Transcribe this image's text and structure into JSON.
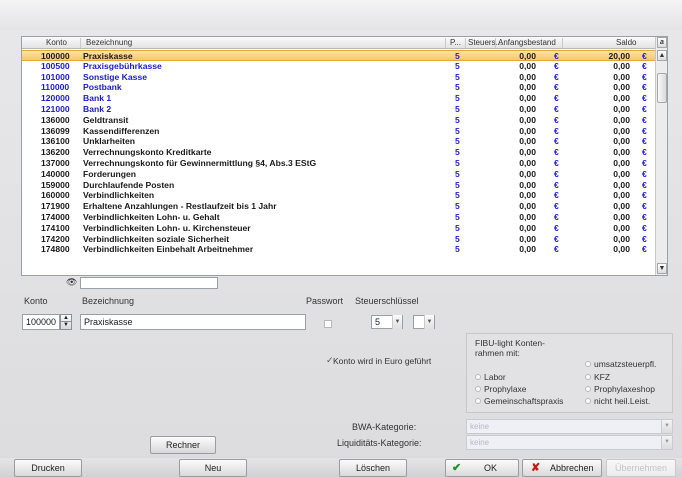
{
  "table": {
    "headers": {
      "konto": "Konto",
      "bezeichnung": "Bezeichnung",
      "p": "P...",
      "steuer": "Steuers...",
      "anfang": "Anfangsbestand",
      "saldo": "Saldo",
      "extra": "a"
    },
    "rows": [
      {
        "konto": "100000",
        "bez": "Praxiskasse",
        "st": "5",
        "anf": "0,00",
        "e1": "€",
        "saldo": "20,00",
        "e2": "€",
        "blue": false,
        "selected": true
      },
      {
        "konto": "100500",
        "bez": "Praxisgebührkasse",
        "st": "5",
        "anf": "0,00",
        "e1": "€",
        "saldo": "0,00",
        "e2": "€",
        "blue": true,
        "selected": false
      },
      {
        "konto": "101000",
        "bez": "Sonstige Kasse",
        "st": "5",
        "anf": "0,00",
        "e1": "€",
        "saldo": "0,00",
        "e2": "€",
        "blue": true,
        "selected": false
      },
      {
        "konto": "110000",
        "bez": "Postbank",
        "st": "5",
        "anf": "0,00",
        "e1": "€",
        "saldo": "0,00",
        "e2": "€",
        "blue": true,
        "selected": false
      },
      {
        "konto": "120000",
        "bez": "Bank 1",
        "st": "5",
        "anf": "0,00",
        "e1": "€",
        "saldo": "0,00",
        "e2": "€",
        "blue": true,
        "selected": false
      },
      {
        "konto": "121000",
        "bez": "Bank 2",
        "st": "5",
        "anf": "0,00",
        "e1": "€",
        "saldo": "0,00",
        "e2": "€",
        "blue": true,
        "selected": false
      },
      {
        "konto": "136000",
        "bez": "Geldtransit",
        "st": "5",
        "anf": "0,00",
        "e1": "€",
        "saldo": "0,00",
        "e2": "€",
        "blue": false,
        "selected": false
      },
      {
        "konto": "136099",
        "bez": "Kassendifferenzen",
        "st": "5",
        "anf": "0,00",
        "e1": "€",
        "saldo": "0,00",
        "e2": "€",
        "blue": false,
        "selected": false
      },
      {
        "konto": "136100",
        "bez": "Unklarheiten",
        "st": "5",
        "anf": "0,00",
        "e1": "€",
        "saldo": "0,00",
        "e2": "€",
        "blue": false,
        "selected": false
      },
      {
        "konto": "136200",
        "bez": "Verrechnungskonto Kreditkarte",
        "st": "5",
        "anf": "0,00",
        "e1": "€",
        "saldo": "0,00",
        "e2": "€",
        "blue": false,
        "selected": false
      },
      {
        "konto": "137000",
        "bez": "Verrechnungskonto für Gewinnermittlung §4, Abs.3 EStG",
        "st": "5",
        "anf": "0,00",
        "e1": "€",
        "saldo": "0,00",
        "e2": "€",
        "blue": false,
        "selected": false
      },
      {
        "konto": "140000",
        "bez": "Forderungen",
        "st": "5",
        "anf": "0,00",
        "e1": "€",
        "saldo": "0,00",
        "e2": "€",
        "blue": false,
        "selected": false
      },
      {
        "konto": "159000",
        "bez": "Durchlaufende Posten",
        "st": "5",
        "anf": "0,00",
        "e1": "€",
        "saldo": "0,00",
        "e2": "€",
        "blue": false,
        "selected": false
      },
      {
        "konto": "160000",
        "bez": "Verbindlichkeiten",
        "st": "5",
        "anf": "0,00",
        "e1": "€",
        "saldo": "0,00",
        "e2": "€",
        "blue": false,
        "selected": false
      },
      {
        "konto": "171900",
        "bez": "Erhaltene Anzahlungen - Restlaufzeit bis 1 Jahr",
        "st": "5",
        "anf": "0,00",
        "e1": "€",
        "saldo": "0,00",
        "e2": "€",
        "blue": false,
        "selected": false
      },
      {
        "konto": "174000",
        "bez": "Verbindlichkeiten Lohn- u. Gehalt",
        "st": "5",
        "anf": "0,00",
        "e1": "€",
        "saldo": "0,00",
        "e2": "€",
        "blue": false,
        "selected": false
      },
      {
        "konto": "174100",
        "bez": "Verbindlichkeiten Lohn- u. Kirchensteuer",
        "st": "5",
        "anf": "0,00",
        "e1": "€",
        "saldo": "0,00",
        "e2": "€",
        "blue": false,
        "selected": false
      },
      {
        "konto": "174200",
        "bez": "Verbindlichkeiten soziale Sicherheit",
        "st": "5",
        "anf": "0,00",
        "e1": "€",
        "saldo": "0,00",
        "e2": "€",
        "blue": false,
        "selected": false
      },
      {
        "konto": "174800",
        "bez": "Verbindlichkeiten Einbehalt Arbeitnehmer",
        "st": "5",
        "anf": "0,00",
        "e1": "€",
        "saldo": "0,00",
        "e2": "€",
        "blue": false,
        "selected": false
      }
    ]
  },
  "form": {
    "konto_label": "Konto",
    "konto_value": "100000",
    "bez_label": "Bezeichnung",
    "bez_value": "Praxiskasse",
    "passwort_label": "Passwort",
    "steuer_label": "Steuerschlüssel",
    "steuer_value": "5",
    "euro_check_label": "Konto wird in Euro geführt",
    "fibu_title_1": "FIBU-light Konten-",
    "fibu_title_2": "rahmen mit:",
    "options": {
      "labor": "Labor",
      "prophylaxe": "Prophylaxe",
      "gemeinschaft": "Gemeinschaftspraxis",
      "umsatz": "umsatzsteuerpfl.",
      "kfz": "KFZ",
      "prophylaxeshop": "Prophylaxeshop",
      "nichtheil": "nicht heil.Leist."
    },
    "bwa_label": "BWA-Kategorie:",
    "bwa_value": "keine",
    "liq_label": "Liquiditäts-Kategorie:",
    "liq_value": "keine"
  },
  "buttons": {
    "rechner": "Rechner",
    "drucken": "Drucken",
    "neu": "Neu",
    "loeschen": "Löschen",
    "ok": "OK",
    "abbrechen": "Abbrechen",
    "uebernehmen": "Übernehmen"
  },
  "colors": {
    "accent_blue": "#1a1ad8",
    "selection": "#f8c76a",
    "ok_green": "#1f8f1f",
    "cancel_red": "#c0201a"
  }
}
